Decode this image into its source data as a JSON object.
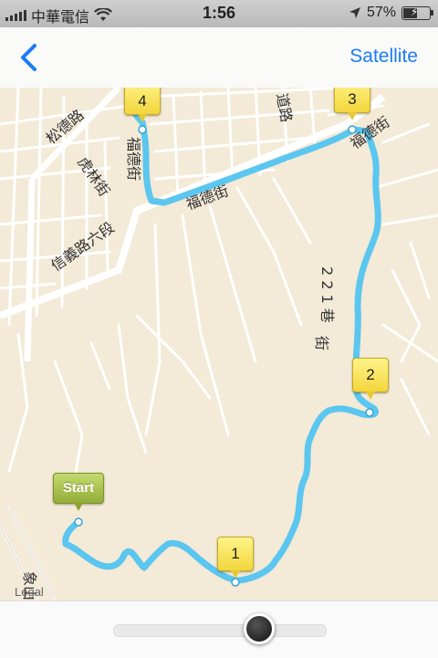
{
  "status_bar": {
    "carrier": "中華電信",
    "time": "1:56",
    "battery_text": "57%",
    "battery_level": 0.57,
    "icons": [
      "signal-icon",
      "wifi-icon",
      "location-arrow-icon",
      "battery-icon"
    ]
  },
  "nav": {
    "back_icon": "chevron-left-icon",
    "satellite_label": "Satellite",
    "accent_color": "#1a7cf5"
  },
  "map": {
    "street_labels": {
      "songde": "松德路",
      "hulin": "虎林街",
      "xinyi": "信義路六段",
      "fude": "福德街",
      "fude_right": "福德街",
      "lane": "2 2 1 巷",
      "lane_prefix": "街",
      "daolu": "道路",
      "vertical_top": "福德街",
      "bottom": "象山"
    },
    "legal": "Legal",
    "route_color": "#5bc6ef",
    "pins": {
      "start": "Start",
      "p1": "1",
      "p2": "2",
      "p3": "3",
      "p4": "4"
    }
  },
  "slider": {
    "value": 0.69
  }
}
